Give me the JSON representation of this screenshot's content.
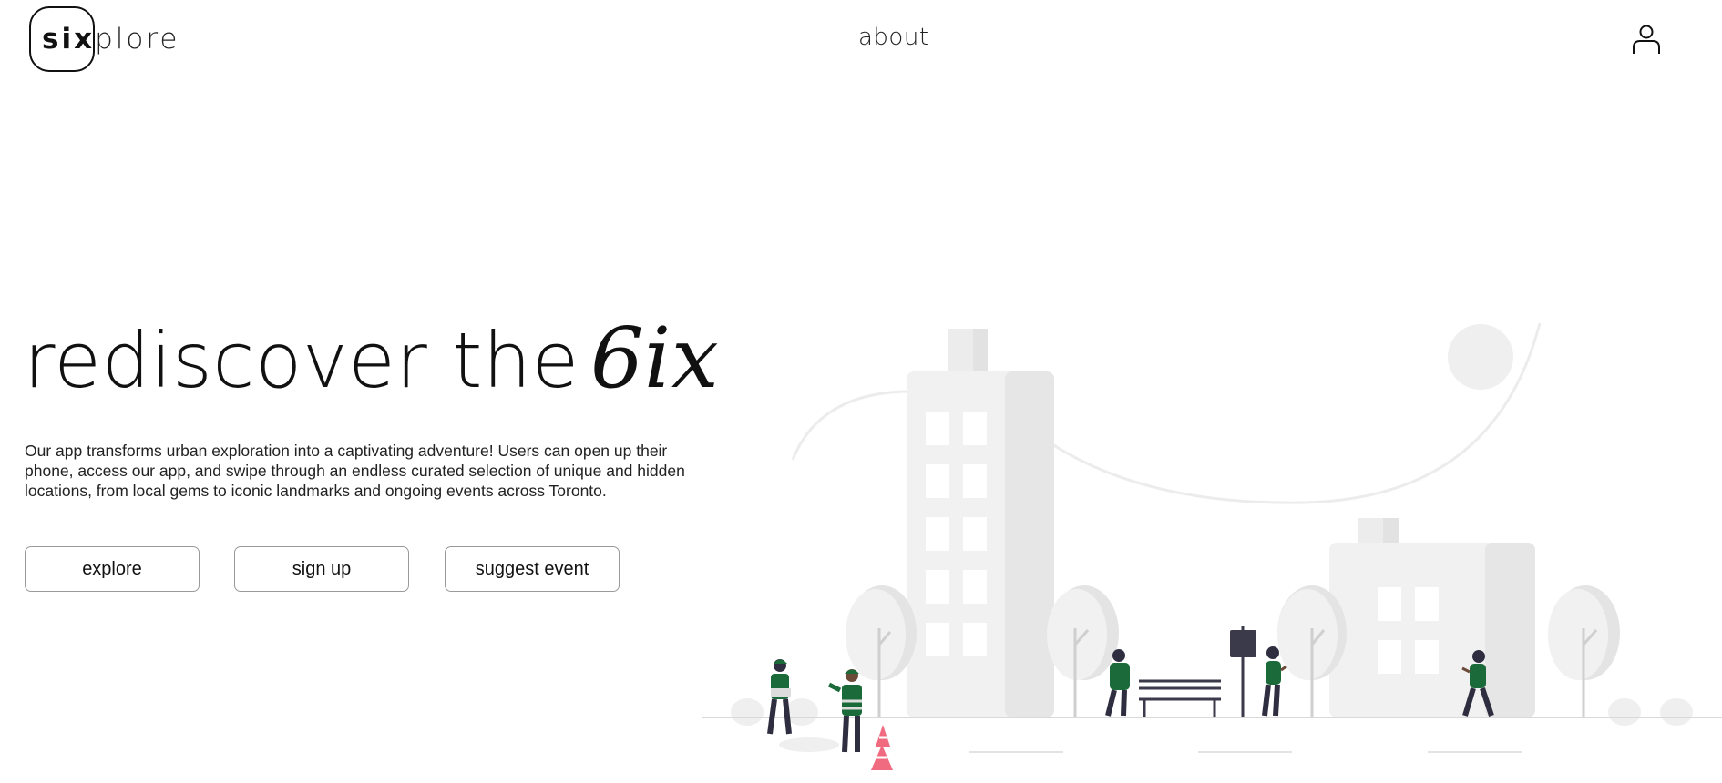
{
  "header": {
    "logo_bold": "six",
    "logo_light": "plore",
    "about_label": "about",
    "account_icon": "user-icon"
  },
  "hero": {
    "title": "rediscover the",
    "title_script": "6ix",
    "description": "Our app transforms urban exploration into a captivating adventure! Users can open up their phone, access our app, and swipe through an endless curated selection of unique and hidden locations, from local gems to iconic landmarks and ongoing events across Toronto."
  },
  "buttons": {
    "explore": "explore",
    "signup": "sign up",
    "suggest": "suggest event"
  },
  "illustration": {
    "scene": "city-park-illustration",
    "accent_color": "#1b6b3a",
    "cone_color": "#f06b7f"
  }
}
